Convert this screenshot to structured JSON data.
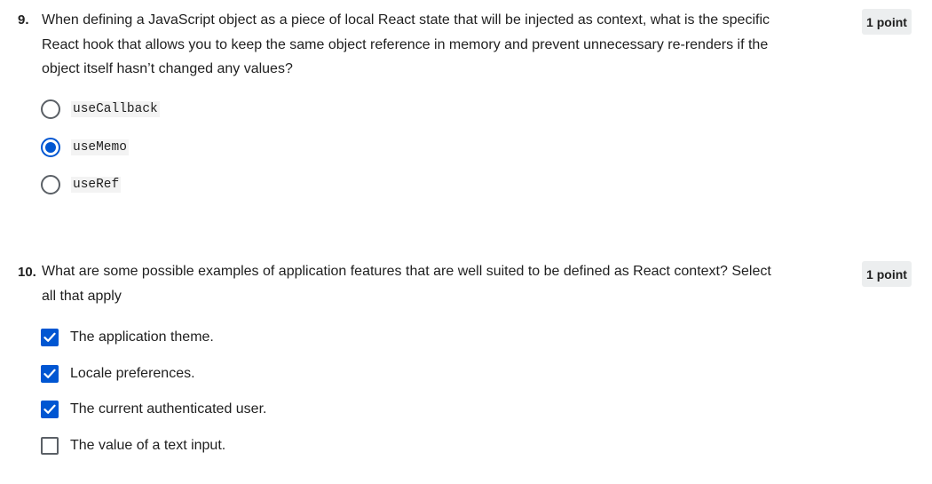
{
  "question9": {
    "number": "9.",
    "text": "When defining a JavaScript object as a piece of local React state that will be injected as context, what is the specific React hook that allows you to keep the same object reference in memory and prevent unnecessary re-renders if the object itself hasn’t changed any values?",
    "points": "1 point",
    "options": [
      {
        "label": "useCallback",
        "selected": false
      },
      {
        "label": "useMemo",
        "selected": true
      },
      {
        "label": "useRef",
        "selected": false
      }
    ]
  },
  "question10": {
    "number": "10.",
    "text": "What are some possible examples of application features that are well suited to be defined as React context? Select all that apply",
    "points": "1 point",
    "options": [
      {
        "label": "The application theme.",
        "checked": true
      },
      {
        "label": "Locale preferences.",
        "checked": true
      },
      {
        "label": "The current authenticated user.",
        "checked": true
      },
      {
        "label": "The value of a text input.",
        "checked": false
      }
    ]
  },
  "colors": {
    "accent": "#0056d2",
    "control_border": "#5b6066",
    "points_badge_bg": "#eceeef"
  }
}
